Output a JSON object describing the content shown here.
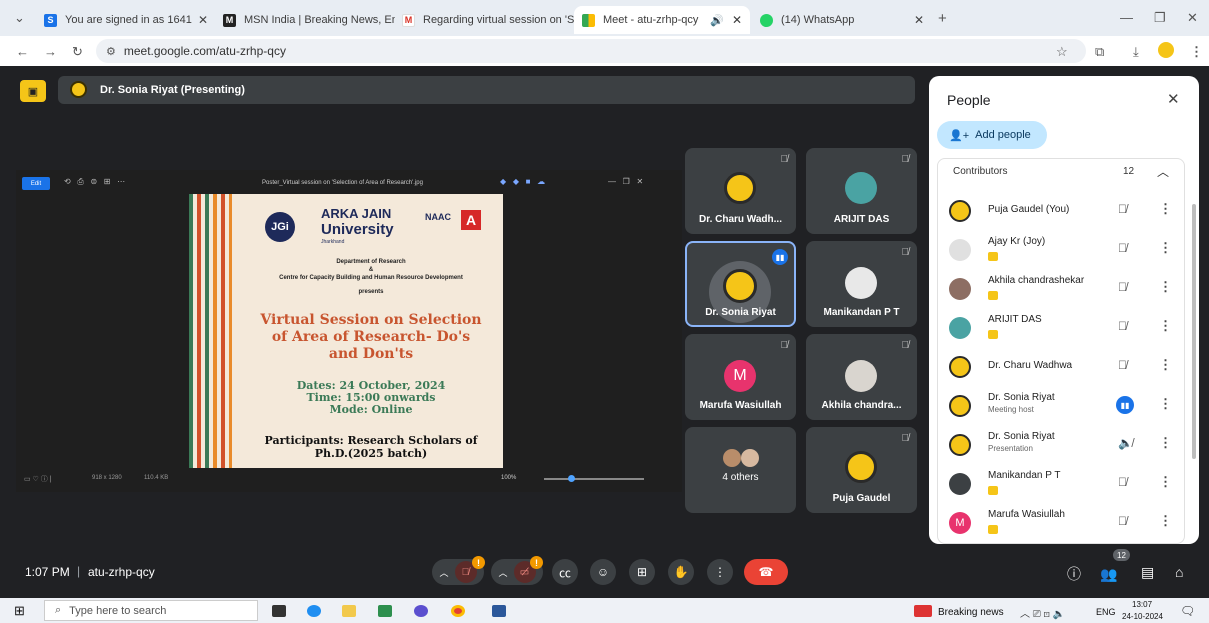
{
  "browser": {
    "tabs": [
      {
        "title": "You are signed in as 1641",
        "favicon": "S"
      },
      {
        "title": "MSN India | Breaking News, Ent",
        "favicon": "M"
      },
      {
        "title": "Regarding virtual session on 'Se",
        "favicon": "M"
      },
      {
        "title": "Meet - atu-zrhp-qcy",
        "favicon": "meet"
      },
      {
        "title": "(14) WhatsApp",
        "favicon": "wa"
      }
    ],
    "url": "meet.google.com/atu-zrhp-qcy"
  },
  "meet": {
    "presenter_label": "Dr. Sonia Riyat (Presenting)",
    "meeting_time": "1:07 PM",
    "meeting_code": "atu-zrhp-qcy",
    "people_count_badge": "12",
    "mic_warning": "!",
    "cam_warning": "!"
  },
  "viewer": {
    "title": "Poster_Virtual session on 'Selection of Area of Research'.jpg",
    "edit_label": "Edit",
    "dims": "918 x 1280",
    "size": "110.4 KB",
    "zoom": "100%"
  },
  "poster": {
    "org1": "ARKA JAIN",
    "org2": "University",
    "org3": "Jharkhand",
    "logo": "JGi",
    "naac": "NAAC",
    "naac_grade": "A",
    "dept": "Department of Research",
    "amp": "&",
    "centre": "Centre for Capacity Building and Human Resource Development",
    "presents": "presents",
    "headline1": "Virtual Session on Selection",
    "headline2": "of Area of Research- Do's",
    "headline3": "and Don'ts",
    "dates": "Dates: 24 October, 2024",
    "time": "Time: 15:00 onwards",
    "mode": "Mode: Online",
    "participants1": "Participants: Research Scholars of",
    "participants2": "Ph.D.(2025 batch)"
  },
  "tiles": [
    {
      "name": "Dr. Charu Wadh...",
      "avatar": "jain-logo"
    },
    {
      "name": "ARIJIT DAS",
      "avatar": "photo"
    },
    {
      "name": "Dr. Sonia Riyat",
      "avatar": "jain-logo",
      "speaking": true
    },
    {
      "name": "Manikandan P T",
      "avatar": "photo"
    },
    {
      "name": "Marufa Wasiullah",
      "avatar": "M",
      "color": "#e8336d"
    },
    {
      "name": "Akhila chandra...",
      "avatar": "photo"
    },
    {
      "name": "4 others",
      "avatar": "group"
    },
    {
      "name": "Puja Gaudel",
      "avatar": "jain-logo"
    }
  ],
  "people_panel": {
    "title": "People",
    "add_people": "Add people",
    "section": "Contributors",
    "count": "12",
    "people": [
      {
        "name": "Puja Gaudel (You)",
        "sub": "",
        "avatar": "jain-logo"
      },
      {
        "name": "Ajay Kr (Joy)",
        "sub": "",
        "avatar": "grey"
      },
      {
        "name": "Akhila chandrashekar",
        "sub": "",
        "avatar": "photo"
      },
      {
        "name": "ARIJIT DAS",
        "sub": "",
        "avatar": "photo"
      },
      {
        "name": "Dr. Charu Wadhwa",
        "sub": "",
        "avatar": "jain-logo"
      },
      {
        "name": "Dr. Sonia Riyat",
        "sub": "Meeting host",
        "avatar": "jain-logo"
      },
      {
        "name": "Dr. Sonia Riyat",
        "sub": "Presentation",
        "avatar": "jain-logo"
      },
      {
        "name": "Manikandan P T",
        "sub": "",
        "avatar": "photo"
      },
      {
        "name": "Marufa Wasiullah",
        "sub": "",
        "avatar": "M"
      }
    ]
  },
  "taskbar": {
    "search_placeholder": "Type here to search",
    "news": "Breaking news",
    "lang": "ENG",
    "time": "13:07",
    "date": "24-10-2024"
  }
}
